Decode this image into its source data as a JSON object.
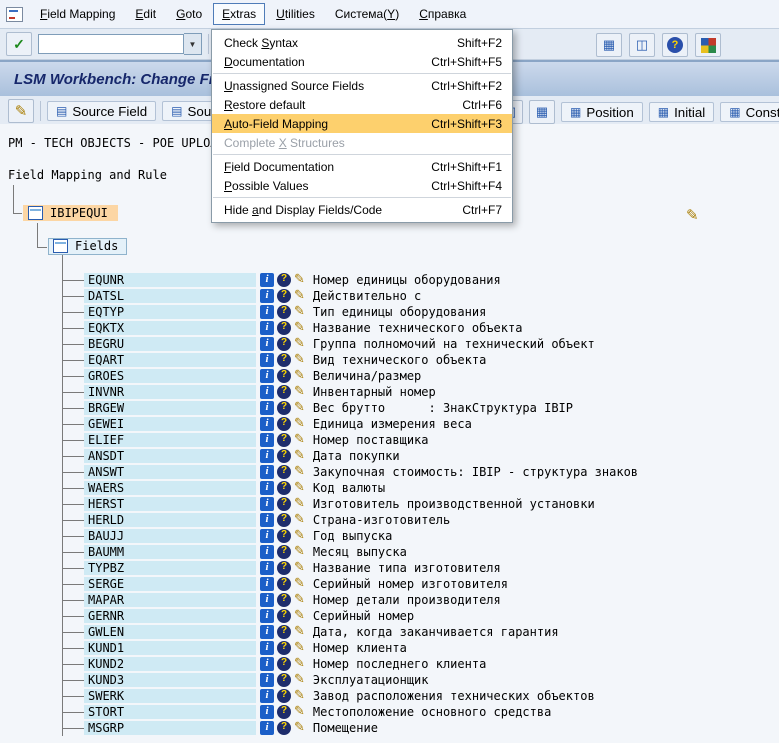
{
  "colors": {
    "selection_orange": "#fcd6a4",
    "menu_highlight": "#fdd06d",
    "field_name_strip": "#cfeaf4",
    "title_text": "#16276b"
  },
  "icons": {
    "info": "i",
    "question": "?",
    "pencil": "✎",
    "check": "✓",
    "combo_arrow": "▼",
    "window": "▦",
    "window2": "◫",
    "help": "?",
    "table": "▤",
    "page": "▥",
    "position": "▦",
    "rule": "▦"
  },
  "menubar": {
    "items": [
      {
        "label": "Field Mapping",
        "accel": 0
      },
      {
        "label": "Edit",
        "accel": 0
      },
      {
        "label": "Goto",
        "accel": 0
      },
      {
        "label": "Extras",
        "accel": 0
      },
      {
        "label": "Utilities",
        "accel": 0
      },
      {
        "label": "Система(Y)",
        "accel": 8
      },
      {
        "label": "Справка",
        "accel": 0
      }
    ]
  },
  "toolbar": {
    "command_field_value": ""
  },
  "title_bar": {
    "title": "LSM Workbench: Change Field Mapping and Conversion Rules"
  },
  "app_toolbar": {
    "source_field_1": "Source Field",
    "source_field_2": "Source Field",
    "position": "Position",
    "initial": "Initial",
    "constant": "Constant"
  },
  "extras_menu": {
    "items": [
      {
        "label": "Check Syntax",
        "shortcut": "Shift+F2",
        "accel": 6
      },
      {
        "label": "Documentation",
        "shortcut": "Ctrl+Shift+F5",
        "accel": 0
      },
      {
        "label": "Unassigned Source Fields",
        "shortcut": "Ctrl+Shift+F2",
        "accel": 0
      },
      {
        "label": "Restore default",
        "shortcut": "Ctrl+F6",
        "accel": 0
      },
      {
        "label": "Auto-Field Mapping",
        "shortcut": "Ctrl+Shift+F3",
        "accel": 0,
        "highlighted": true
      },
      {
        "label": "Complete X Structures",
        "shortcut": "",
        "accel": 9,
        "disabled": true
      },
      {
        "label": "Field Documentation",
        "shortcut": "Ctrl+Shift+F1",
        "accel": 0
      },
      {
        "label": "Possible Values",
        "shortcut": "Ctrl+Shift+F4",
        "accel": 0
      },
      {
        "label": "Hide and Display Fields/Code",
        "shortcut": "Ctrl+F7",
        "accel": 5
      }
    ]
  },
  "content": {
    "program_line": "PM - TECH OBJECTS - POE UPLOAD",
    "tree_root": "Field Mapping and Rule",
    "structure_node": "IBIPEQUI",
    "fields_node": "Fields",
    "rows": [
      {
        "name": "EQUNR",
        "desc": "Номер единицы оборудования"
      },
      {
        "name": "DATSL",
        "desc": "Действительно с"
      },
      {
        "name": "EQTYP",
        "desc": "Тип единицы оборудования"
      },
      {
        "name": "EQKTX",
        "desc": "Название технического объекта"
      },
      {
        "name": "BEGRU",
        "desc": "Группа полномочий на технический объект"
      },
      {
        "name": "EQART",
        "desc": "Вид технического объекта"
      },
      {
        "name": "GROES",
        "desc": "Величина/размер"
      },
      {
        "name": "INVNR",
        "desc": "Инвентарный номер"
      },
      {
        "name": "BRGEW",
        "desc": "Вес брутто      : ЗнакСтруктура IBIP"
      },
      {
        "name": "GEWEI",
        "desc": "Единица измерения веса"
      },
      {
        "name": "ELIEF",
        "desc": "Номер поставщика"
      },
      {
        "name": "ANSDT",
        "desc": "Дата покупки"
      },
      {
        "name": "ANSWT",
        "desc": "Закупочная стоимость: IBIP - структура знаков"
      },
      {
        "name": "WAERS",
        "desc": "Код валюты"
      },
      {
        "name": "HERST",
        "desc": "Изготовитель производственной установки"
      },
      {
        "name": "HERLD",
        "desc": "Страна-изготовитель"
      },
      {
        "name": "BAUJJ",
        "desc": "Год выпуска"
      },
      {
        "name": "BAUMM",
        "desc": "Месяц выпуска"
      },
      {
        "name": "TYPBZ",
        "desc": "Название типа изготовителя"
      },
      {
        "name": "SERGE",
        "desc": "Серийный номер изготовителя"
      },
      {
        "name": "MAPAR",
        "desc": "Номер детали производителя"
      },
      {
        "name": "GERNR",
        "desc": "Серийный номер"
      },
      {
        "name": "GWLEN",
        "desc": "Дата, когда заканчивается гарантия"
      },
      {
        "name": "KUND1",
        "desc": "Номер клиента"
      },
      {
        "name": "KUND2",
        "desc": "Номер последнего клиента"
      },
      {
        "name": "KUND3",
        "desc": "Эксплуатационщик"
      },
      {
        "name": "SWERK",
        "desc": "Завод расположения технических объектов"
      },
      {
        "name": "STORT",
        "desc": "Местоположение основного средства"
      },
      {
        "name": "MSGRP",
        "desc": "Помещение"
      }
    ]
  }
}
